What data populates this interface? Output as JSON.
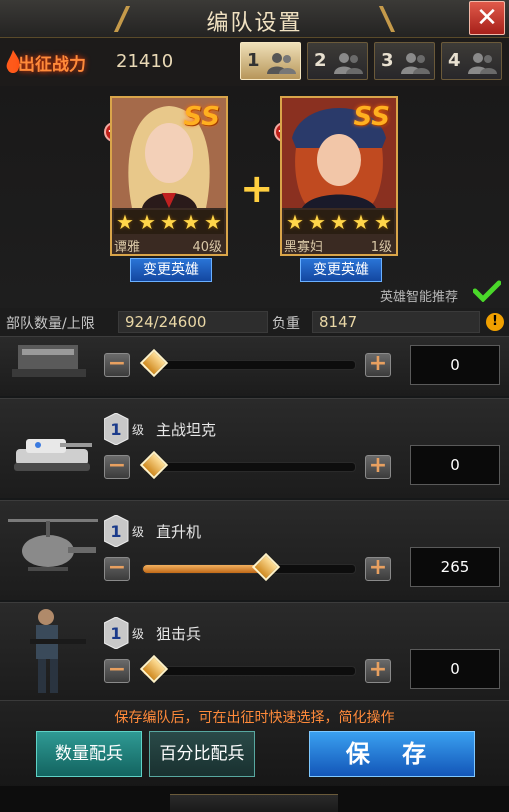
{
  "header": {
    "title": "编队设置",
    "close_icon": "close-icon"
  },
  "power": {
    "label": "出征战力",
    "value": "21410"
  },
  "formation_tabs": [
    {
      "number": "1",
      "active": true
    },
    {
      "number": "2",
      "active": false
    },
    {
      "number": "3",
      "active": false
    },
    {
      "number": "4",
      "active": false
    }
  ],
  "heroes": [
    {
      "name": "谭雅",
      "level": "40级",
      "grade": "SS",
      "stars": 5,
      "change_label": "变更英雄"
    },
    {
      "name": "黑寡妇",
      "level": "1级",
      "grade": "SS",
      "stars": 5,
      "change_label": "变更英雄"
    }
  ],
  "smart_recommend": {
    "label": "英雄智能推荐",
    "checked": true
  },
  "summary": {
    "troop_label": "部队数量/上限",
    "troop_value": "924/24600",
    "load_label": "负重",
    "load_value": "8147"
  },
  "units": [
    {
      "name": "",
      "level": "",
      "count": "0",
      "fraction": 0.05
    },
    {
      "name": "主战坦克",
      "level": "1",
      "level_suffix": "级",
      "count": "0",
      "fraction": 0.05
    },
    {
      "name": "直升机",
      "level": "1",
      "level_suffix": "级",
      "count": "265",
      "fraction": 0.58
    },
    {
      "name": "狙击兵",
      "level": "1",
      "level_suffix": "级",
      "count": "0",
      "fraction": 0.05
    }
  ],
  "footer": {
    "hint": "保存编队后，可在出征时快速选择，简化操作",
    "quantity_button": "数量配兵",
    "percent_button": "百分比配兵",
    "save_button": "保 存"
  },
  "colors": {
    "accent": "#ff8a3a",
    "slider": "#e8962e",
    "save": "#2a7ee0",
    "teal": "#2f9a94"
  }
}
